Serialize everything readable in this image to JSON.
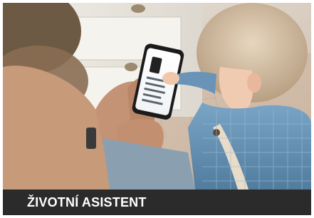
{
  "caption": {
    "title": "ŽIVOTNÍ ASISTENT",
    "background_color": "#2b2b2b",
    "text_color": "#ffffff"
  },
  "photo": {
    "elements": [
      "adult-hands-icon",
      "smartphone-icon",
      "child-icon",
      "dresser-icon"
    ]
  }
}
